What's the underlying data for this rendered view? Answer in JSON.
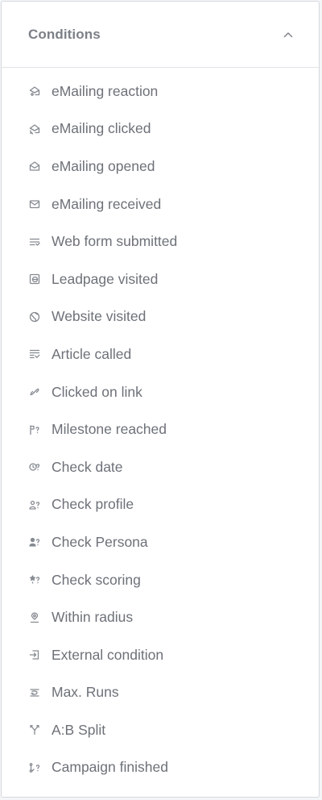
{
  "panel": {
    "title": "Conditions",
    "collapse_icon": "chevron-up-icon"
  },
  "items": [
    {
      "label": "eMailing reaction",
      "icon": "envelope-reaction-icon"
    },
    {
      "label": "eMailing clicked",
      "icon": "envelope-clicked-icon"
    },
    {
      "label": "eMailing opened",
      "icon": "envelope-open-icon"
    },
    {
      "label": "eMailing received",
      "icon": "envelope-icon"
    },
    {
      "label": "Web form submitted",
      "icon": "form-icon"
    },
    {
      "label": "Leadpage visited",
      "icon": "leadpage-icon"
    },
    {
      "label": "Website visited",
      "icon": "globe-icon"
    },
    {
      "label": "Article called",
      "icon": "article-icon"
    },
    {
      "label": "Clicked on link",
      "icon": "link-icon"
    },
    {
      "label": "Milestone reached",
      "icon": "milestone-question-icon"
    },
    {
      "label": "Check date",
      "icon": "clock-question-icon"
    },
    {
      "label": "Check profile",
      "icon": "profile-question-icon"
    },
    {
      "label": "Check Persona",
      "icon": "persona-question-icon"
    },
    {
      "label": "Check scoring",
      "icon": "scoring-question-icon"
    },
    {
      "label": "Within radius",
      "icon": "location-pin-icon"
    },
    {
      "label": "External condition",
      "icon": "external-condition-icon"
    },
    {
      "label": "Max. Runs",
      "icon": "max-runs-icon"
    },
    {
      "label": "A:B Split",
      "icon": "split-icon"
    },
    {
      "label": "Campaign finished",
      "icon": "campaign-finished-icon"
    }
  ],
  "colors": {
    "text": "#6d7178",
    "title": "#7c8087",
    "icon": "#868a91",
    "border": "#d5d9de"
  }
}
